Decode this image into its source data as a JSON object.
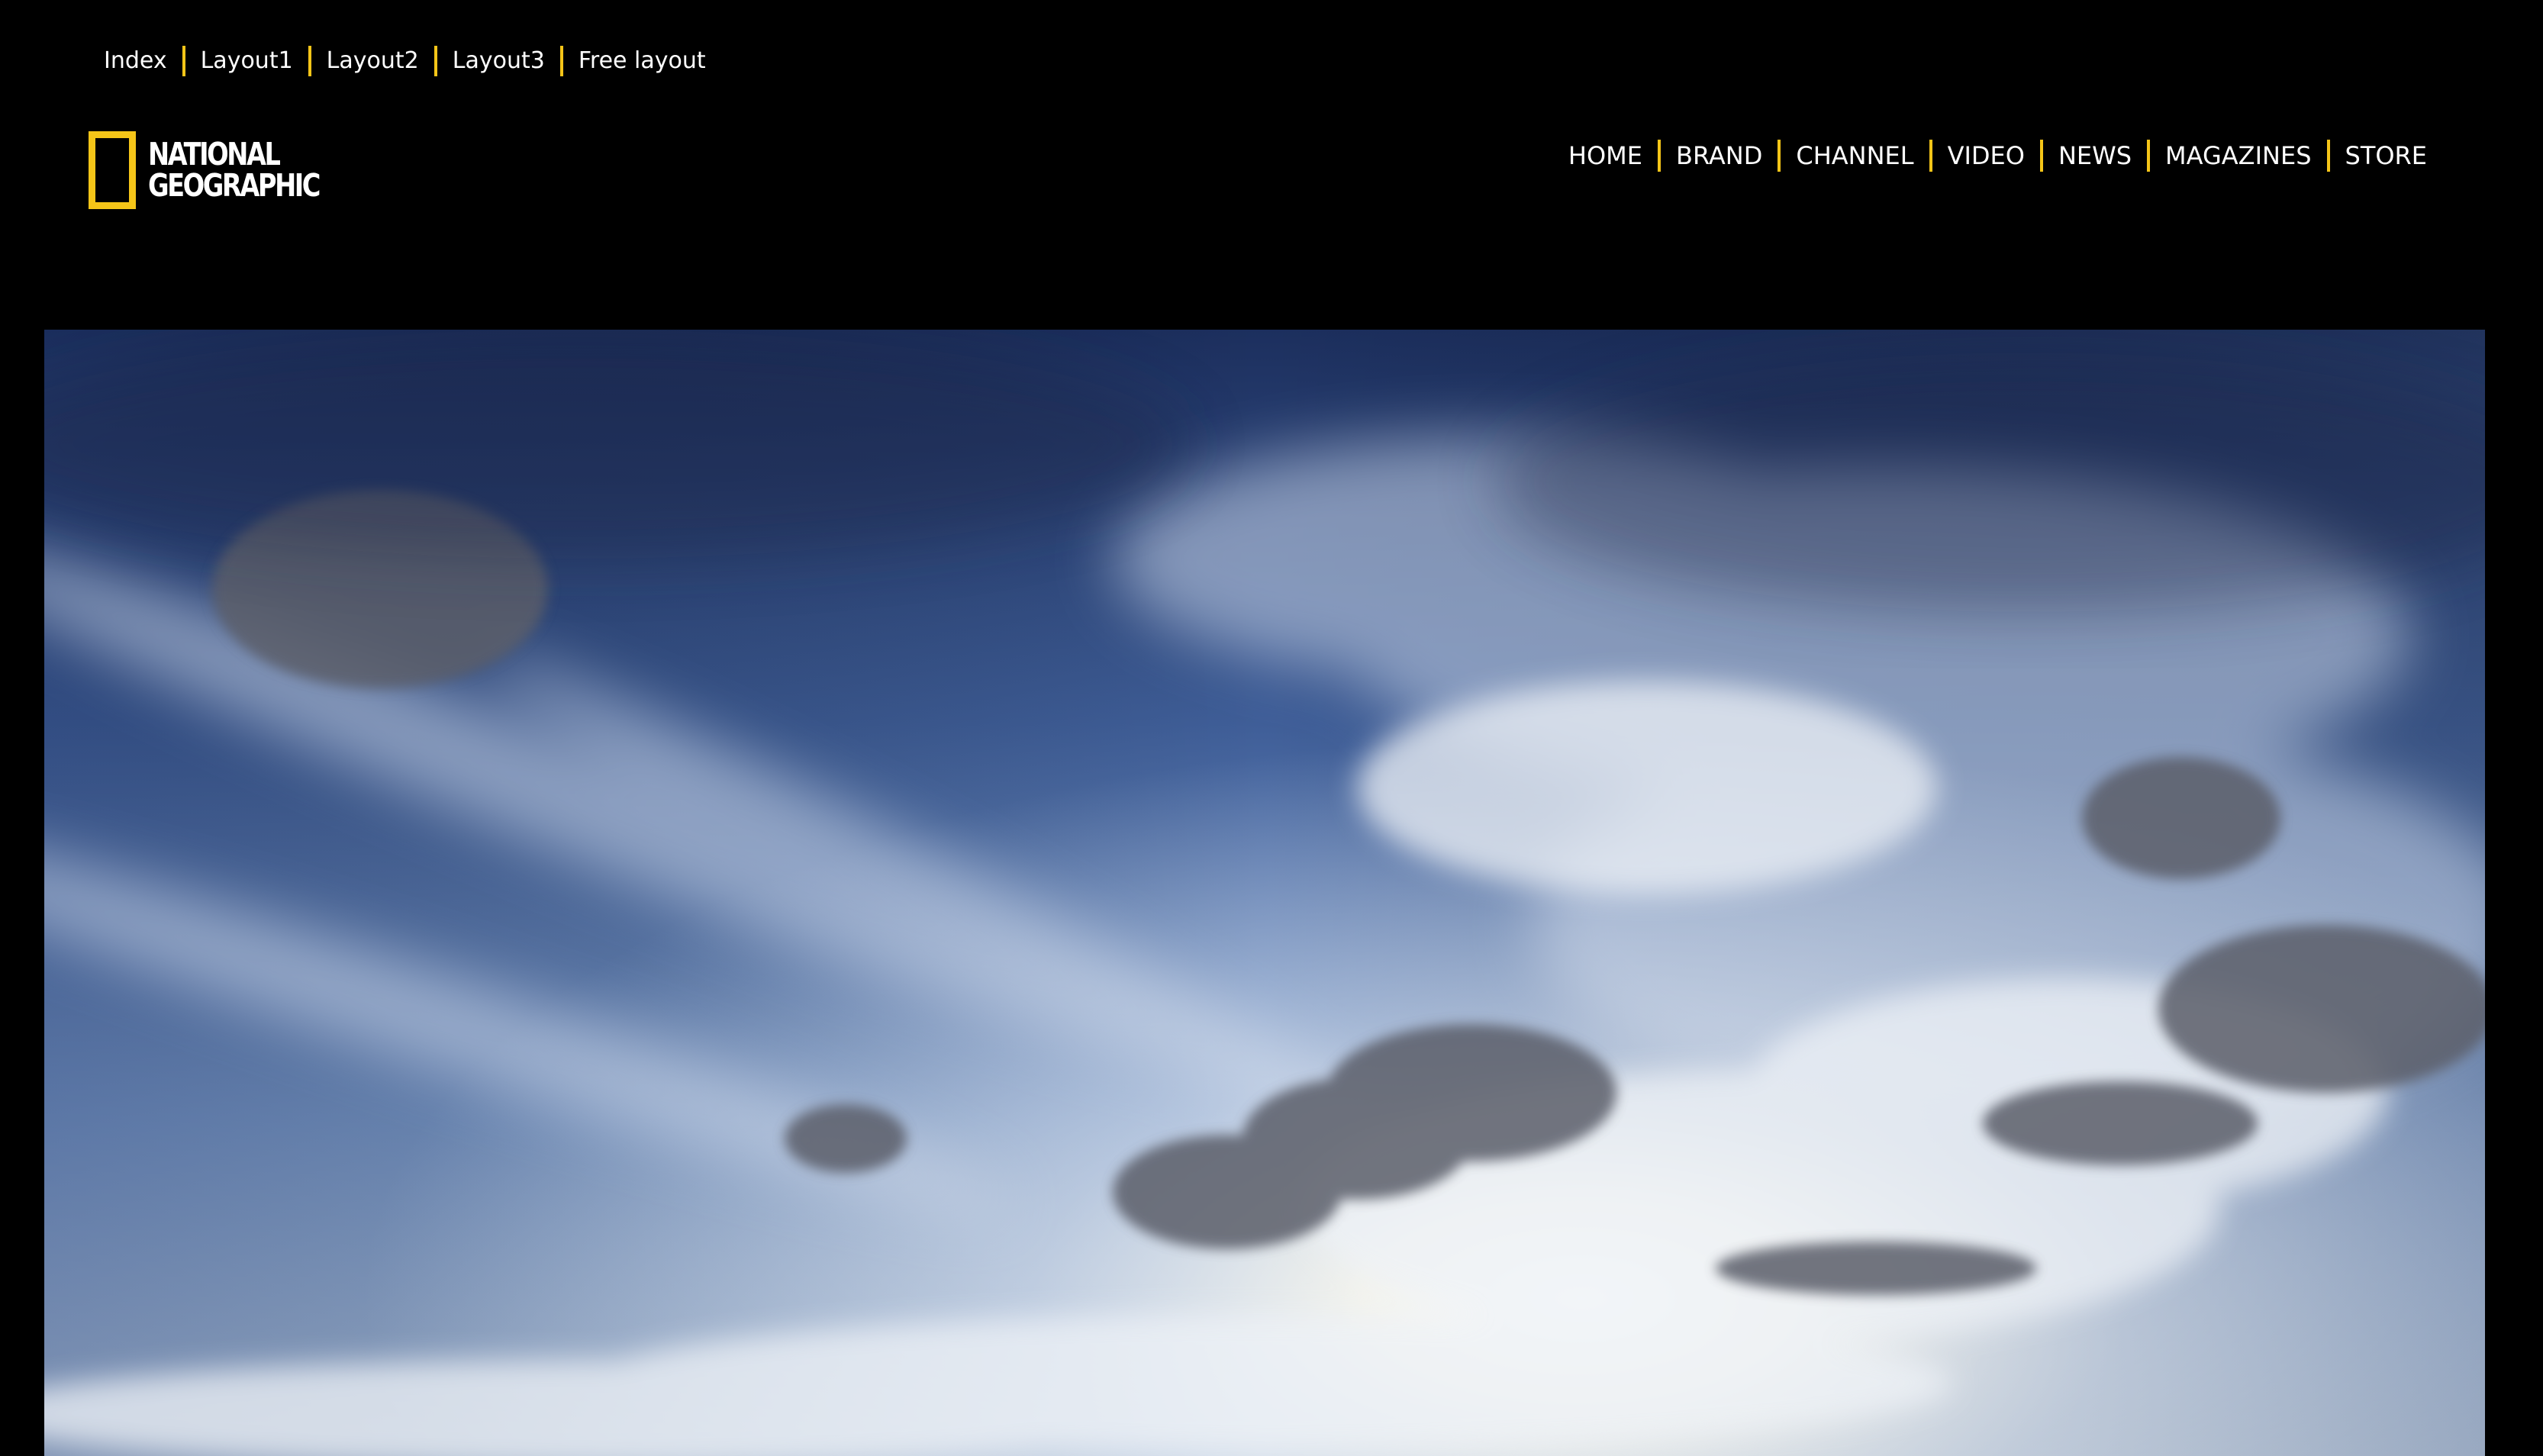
{
  "top_links": [
    "Index",
    "Layout1",
    "Layout2",
    "Layout3",
    "Free layout"
  ],
  "logo": {
    "line1": "NATIONAL",
    "line2": "GEOGRAPHIC"
  },
  "nav": [
    "HOME",
    "BRAND",
    "CHANNEL",
    "VIDEO",
    "NEWS",
    "MAGAZINES",
    "STORE"
  ],
  "colors": {
    "background": "#000000",
    "accent": "#f5c518",
    "text": "#ffffff"
  },
  "hero": {
    "image": "sky-with-clouds"
  }
}
